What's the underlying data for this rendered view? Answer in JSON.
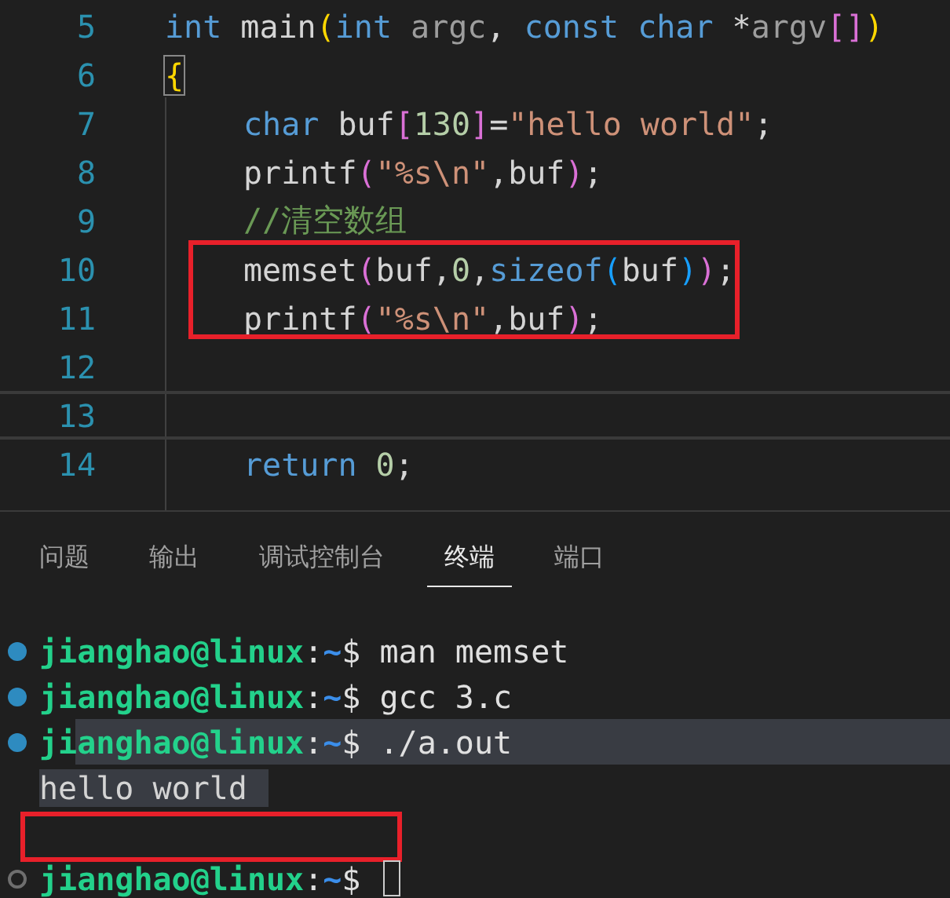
{
  "editor": {
    "lines": [
      {
        "number": "5",
        "current": false,
        "marked": false,
        "indented": false,
        "tokens": [
          {
            "kind": "keyword",
            "text": "int"
          },
          {
            "kind": "plain",
            "text": " main"
          },
          {
            "kind": "bracket1",
            "text": "("
          },
          {
            "kind": "keyword",
            "text": "int"
          },
          {
            "kind": "param",
            "text": " argc"
          },
          {
            "kind": "plain",
            "text": ","
          },
          {
            "kind": "keyword",
            "text": " const char"
          },
          {
            "kind": "plain",
            "text": " *"
          },
          {
            "kind": "param",
            "text": "argv"
          },
          {
            "kind": "bracket2",
            "text": "[]"
          },
          {
            "kind": "bracket1",
            "text": ")"
          }
        ]
      },
      {
        "number": "6",
        "current": false,
        "marked": false,
        "indented": false,
        "tokens": [
          {
            "kind": "brace-match",
            "text": "{"
          }
        ]
      },
      {
        "number": "7",
        "current": false,
        "marked": false,
        "indented": true,
        "tokens": [
          {
            "kind": "keyword",
            "text": "char"
          },
          {
            "kind": "plain",
            "text": " buf"
          },
          {
            "kind": "bracket2",
            "text": "["
          },
          {
            "kind": "number",
            "text": "130"
          },
          {
            "kind": "bracket2",
            "text": "]"
          },
          {
            "kind": "plain",
            "text": "="
          },
          {
            "kind": "string",
            "text": "\"hello world\""
          },
          {
            "kind": "plain",
            "text": ";"
          }
        ]
      },
      {
        "number": "8",
        "current": false,
        "marked": false,
        "indented": true,
        "tokens": [
          {
            "kind": "plain",
            "text": "printf"
          },
          {
            "kind": "bracket2",
            "text": "("
          },
          {
            "kind": "string",
            "text": "\"%s\\n\""
          },
          {
            "kind": "plain",
            "text": ",buf"
          },
          {
            "kind": "bracket2",
            "text": ")"
          },
          {
            "kind": "plain",
            "text": ";"
          }
        ]
      },
      {
        "number": "9",
        "current": false,
        "marked": false,
        "indented": true,
        "tokens": [
          {
            "kind": "comment",
            "text": "//清空数组"
          }
        ]
      },
      {
        "number": "10",
        "current": false,
        "marked": true,
        "indented": true,
        "tokens": [
          {
            "kind": "plain",
            "text": "memset"
          },
          {
            "kind": "bracket2",
            "text": "("
          },
          {
            "kind": "plain",
            "text": "buf,"
          },
          {
            "kind": "number",
            "text": "0"
          },
          {
            "kind": "plain",
            "text": ","
          },
          {
            "kind": "keyword",
            "text": "sizeof"
          },
          {
            "kind": "bracket3",
            "text": "("
          },
          {
            "kind": "plain",
            "text": "buf"
          },
          {
            "kind": "bracket3",
            "text": ")"
          },
          {
            "kind": "bracket2",
            "text": ")"
          },
          {
            "kind": "plain",
            "text": ";"
          }
        ]
      },
      {
        "number": "11",
        "current": false,
        "marked": true,
        "indented": true,
        "tokens": [
          {
            "kind": "plain",
            "text": "printf"
          },
          {
            "kind": "bracket2",
            "text": "("
          },
          {
            "kind": "string",
            "text": "\"%s\\n\""
          },
          {
            "kind": "plain",
            "text": ",buf"
          },
          {
            "kind": "bracket2",
            "text": ")"
          },
          {
            "kind": "plain",
            "text": ";"
          }
        ]
      },
      {
        "number": "12",
        "current": false,
        "marked": false
      },
      {
        "number": "13",
        "current": true,
        "marked": false
      },
      {
        "number": "14",
        "current": false,
        "marked": false,
        "indented": true,
        "tokens": [
          {
            "kind": "keyword",
            "text": "return"
          },
          {
            "kind": "number",
            "text": " 0"
          },
          {
            "kind": "plain",
            "text": ";"
          }
        ]
      }
    ]
  },
  "panel": {
    "tabs": [
      {
        "label": "问题",
        "selected": false
      },
      {
        "label": "输出",
        "selected": false
      },
      {
        "label": "调试控制台",
        "selected": false
      },
      {
        "label": "终端",
        "selected": true
      },
      {
        "label": "端口",
        "selected": false
      }
    ],
    "terminal": [
      {
        "kind": "prompt",
        "finished": true,
        "user": "jianghao@linux",
        "separator": ":",
        "path": "~",
        "symbol": "$",
        "command": "man memset",
        "highlighted": false,
        "marked": false,
        "cursor": false
      },
      {
        "kind": "prompt",
        "finished": true,
        "user": "jianghao@linux",
        "separator": ":",
        "path": "~",
        "symbol": "$",
        "command": "gcc 3.c",
        "highlighted": false,
        "marked": false,
        "cursor": false
      },
      {
        "kind": "prompt",
        "finished": true,
        "user": "jianghao@linux",
        "separator": ":",
        "path": "~",
        "symbol": "$",
        "command": "./a.out",
        "highlighted": true,
        "marked": false,
        "cursor": false
      },
      {
        "kind": "output",
        "text": "hello world",
        "highlighted": true,
        "marked": false
      },
      {
        "kind": "output",
        "marked": true
      },
      {
        "kind": "prompt",
        "finished": false,
        "user": "jianghao@linux",
        "separator": ":",
        "path": "~",
        "symbol": "$",
        "highlighted": false,
        "marked": false,
        "cursor": true
      }
    ]
  }
}
